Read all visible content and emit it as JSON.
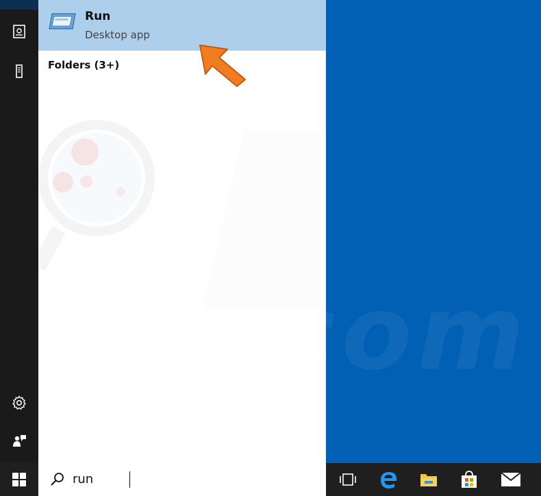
{
  "search_results": {
    "best_match": {
      "title": "Run",
      "subtitle": "Desktop app",
      "icon": "run-app-icon"
    },
    "folders_header": "Folders (3+)"
  },
  "left_rail": {
    "icons": [
      "document-icon",
      "tower-icon",
      "gear-icon",
      "feedback-icon"
    ]
  },
  "taskbar": {
    "search_value": "run",
    "icons": [
      "windows-start-icon",
      "task-view-icon",
      "edge-icon",
      "file-explorer-icon",
      "store-icon",
      "mail-icon"
    ]
  },
  "watermark": {
    "text": "risk.com"
  },
  "colors": {
    "desktop": "#0160b4",
    "selection": "#aecfeb",
    "taskbar": "#1f1f1f",
    "rail": "#1a1a1a",
    "arrow": "#f07d22"
  }
}
